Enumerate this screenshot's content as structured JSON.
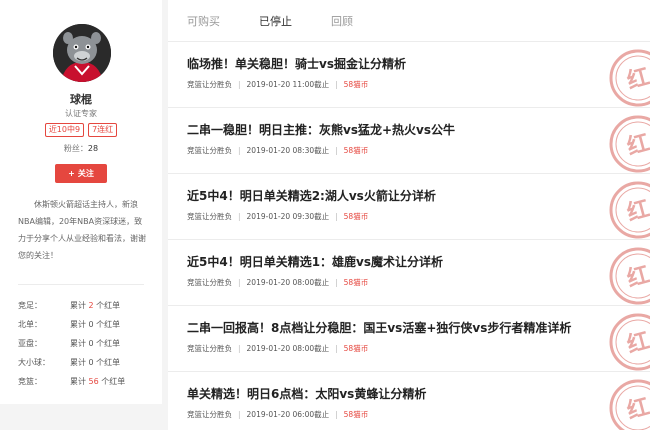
{
  "profile": {
    "name": "球棍",
    "cert": "认证专家",
    "badges": [
      "近10中9",
      "7连红"
    ],
    "fans_label": "粉丝：",
    "fans_count": "28",
    "follow_label": "关注",
    "bio": "休斯顿火箭超话主持人，新浪NBA编辑，20年NBA资深球迷，致力于分享个人从业经验和看法，谢谢您的关注！",
    "stats": [
      {
        "key": "竞足：",
        "prefix": "累计 ",
        "num": "2",
        "suffix": " 个红单",
        "highlight": true
      },
      {
        "key": "北单：",
        "prefix": "累计 ",
        "num": "0",
        "suffix": " 个红单",
        "highlight": false
      },
      {
        "key": "亚盘：",
        "prefix": "累计 ",
        "num": "0",
        "suffix": " 个红单",
        "highlight": false
      },
      {
        "key": "大小球：",
        "prefix": "累计 ",
        "num": "0",
        "suffix": " 个红单",
        "highlight": false
      },
      {
        "key": "竞篮：",
        "prefix": "累计 ",
        "num": "56",
        "suffix": " 个红单",
        "highlight": true
      }
    ]
  },
  "tabs": [
    {
      "label": "可购买",
      "active": false
    },
    {
      "label": "已停止",
      "active": true
    },
    {
      "label": "回顾",
      "active": false
    }
  ],
  "stamp_text": "红",
  "colors": {
    "accent": "#e5473f",
    "stamp": "#e9a8a4"
  },
  "items": [
    {
      "title": "临场推！单关稳胆！骑士vs掘金让分精析",
      "category": "竞篮让分胜负",
      "time": "2019-01-20 11:00截止",
      "price": "58猫币"
    },
    {
      "title": "二串一稳胆！明日主推：灰熊vs猛龙+热火vs公牛",
      "category": "竞篮让分胜负",
      "time": "2019-01-20 08:30截止",
      "price": "58猫币"
    },
    {
      "title": "近5中4！明日单关精选2:湖人vs火箭让分详析",
      "category": "竞篮让分胜负",
      "time": "2019-01-20 09:30截止",
      "price": "58猫币"
    },
    {
      "title": "近5中4！明日单关精选1：雄鹿vs魔术让分详析",
      "category": "竞篮让分胜负",
      "time": "2019-01-20 08:00截止",
      "price": "58猫币"
    },
    {
      "title": "二串一回报高！8点档让分稳胆：国王vs活塞+独行侠vs步行者精准详析",
      "category": "竞篮让分胜负",
      "time": "2019-01-20 08:00截止",
      "price": "58猫币"
    },
    {
      "title": "单关精选！明日6点档：太阳vs黄蜂让分精析",
      "category": "竞篮让分胜负",
      "time": "2019-01-20 06:00截止",
      "price": "58猫币"
    }
  ]
}
